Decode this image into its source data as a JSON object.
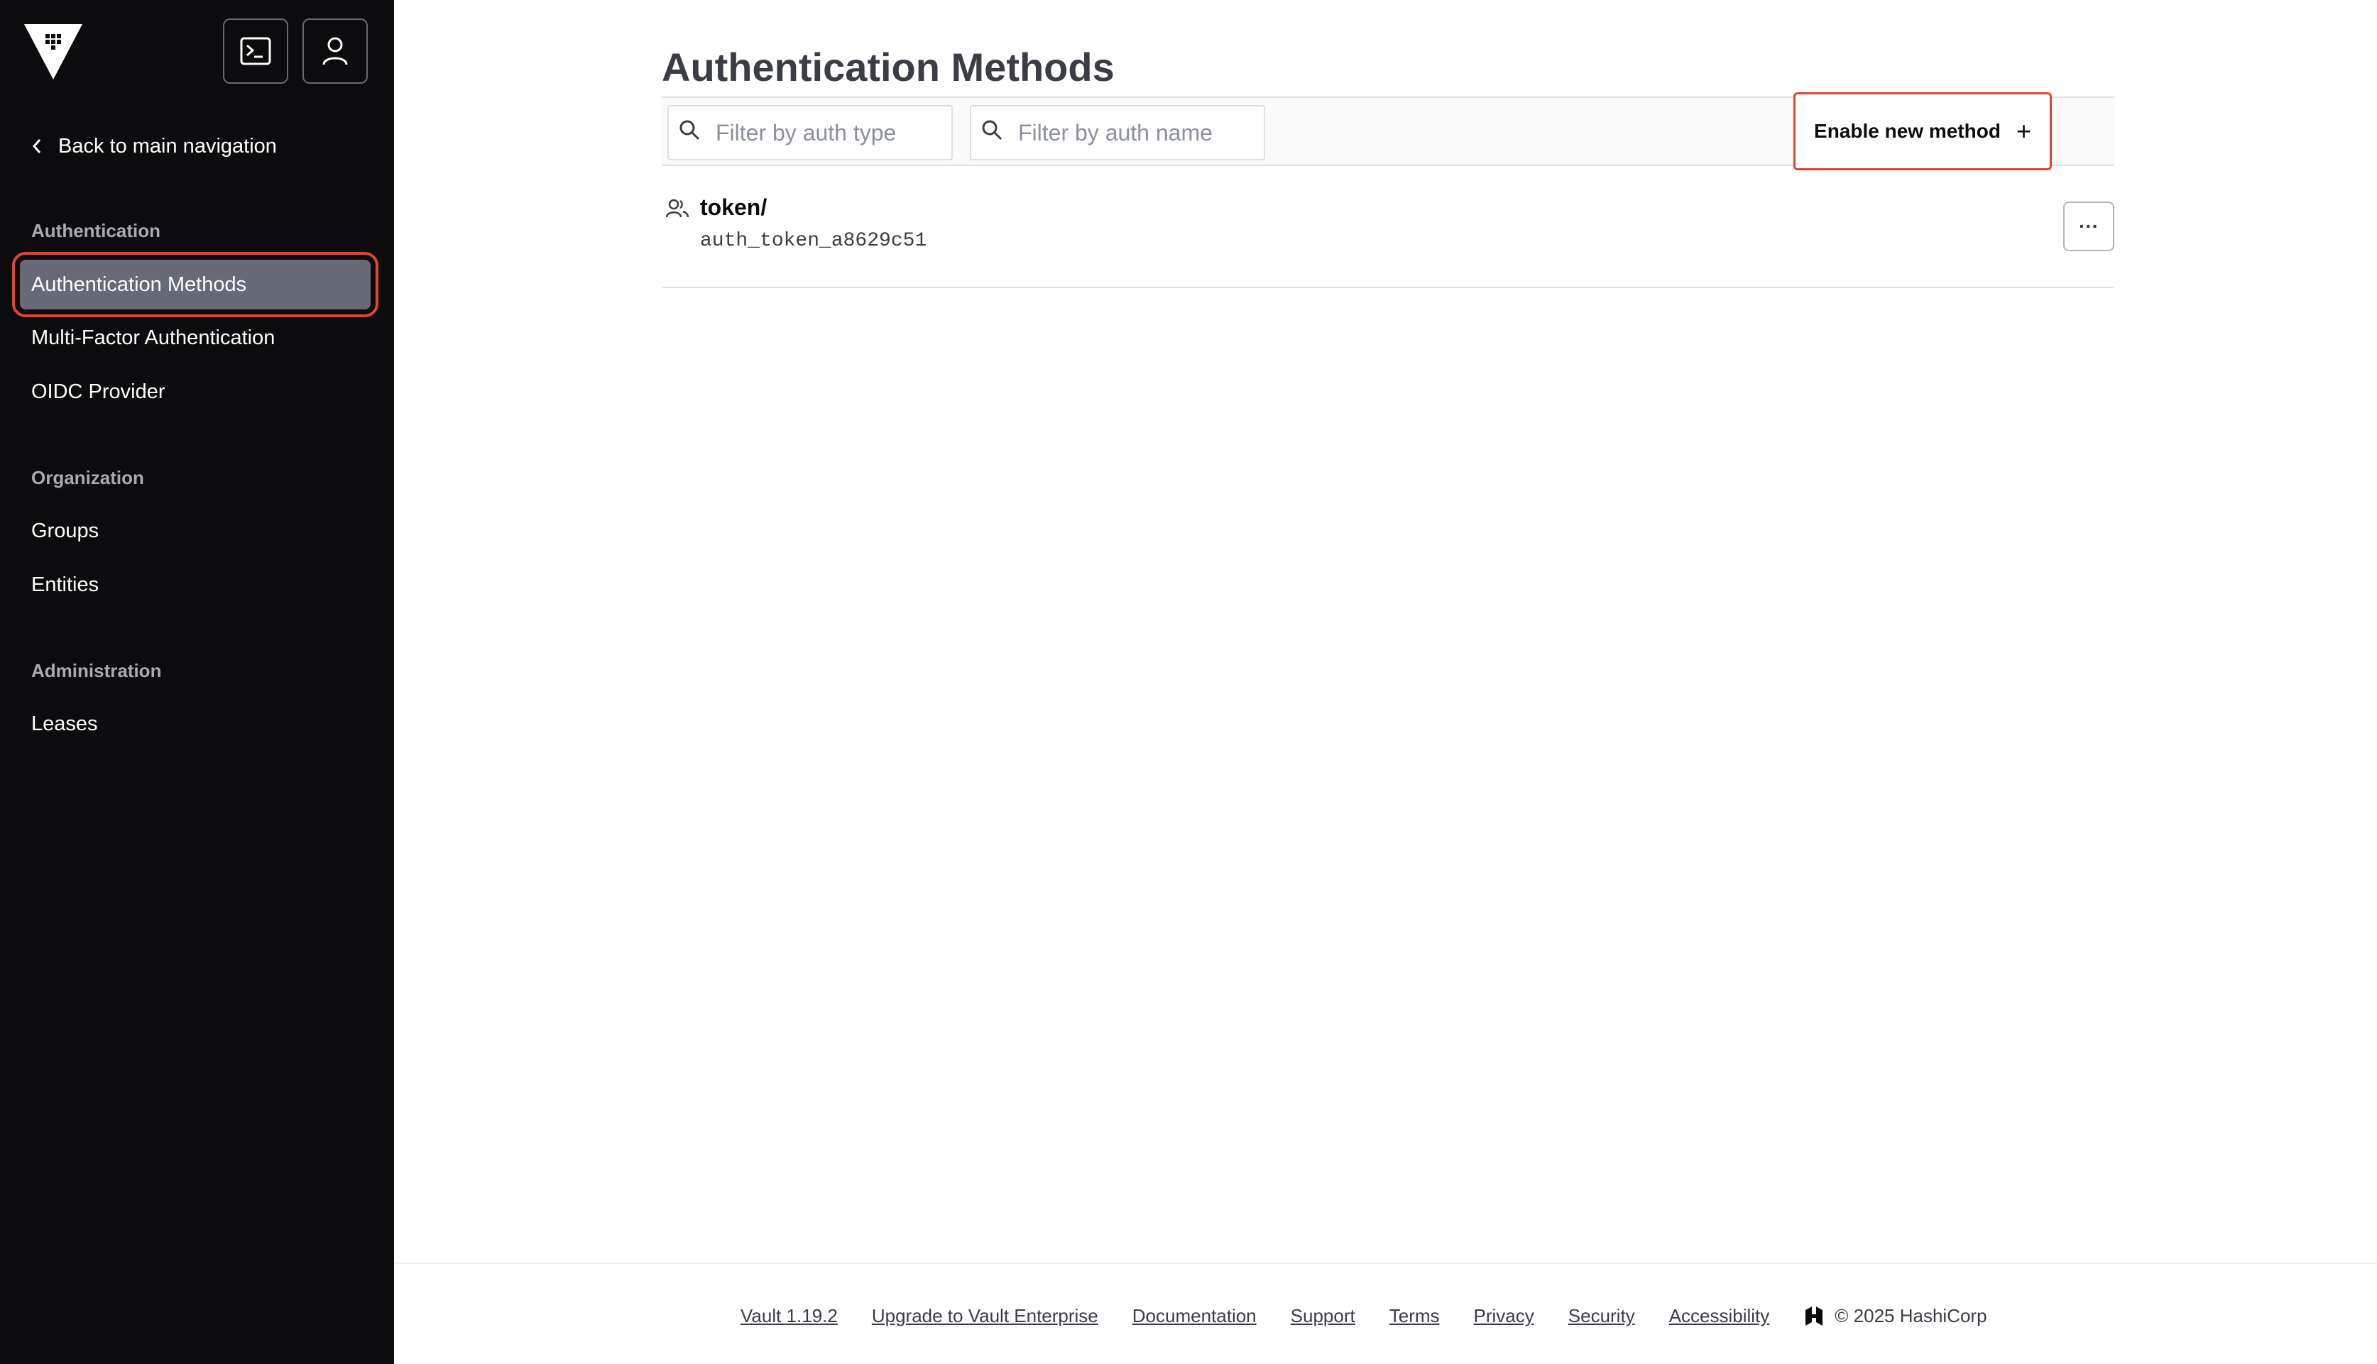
{
  "sidebar": {
    "back_label": "Back to main navigation",
    "sections": [
      {
        "label": "Authentication",
        "items": [
          "Authentication Methods",
          "Multi-Factor Authentication",
          "OIDC Provider"
        ]
      },
      {
        "label": "Organization",
        "items": [
          "Groups",
          "Entities"
        ]
      },
      {
        "label": "Administration",
        "items": [
          "Leases"
        ]
      }
    ],
    "active_item": "Authentication Methods"
  },
  "main": {
    "title": "Authentication Methods",
    "filters": {
      "type_placeholder": "Filter by auth type",
      "name_placeholder": "Filter by auth name"
    },
    "enable_button_label": "Enable new method",
    "enable_button_icon": "+",
    "methods": [
      {
        "path": "token/",
        "accessor": "auth_token_a8629c51",
        "menu_label": "···"
      }
    ]
  },
  "footer": {
    "links": [
      "Vault 1.19.2",
      "Upgrade to Vault Enterprise",
      "Documentation",
      "Support",
      "Terms",
      "Privacy",
      "Security",
      "Accessibility"
    ],
    "copyright": "© 2025 HashiCorp"
  },
  "colors": {
    "sidebar_bg": "#0c0c0e",
    "active_item_bg": "#656a76",
    "highlight_outline": "#e5432d"
  }
}
